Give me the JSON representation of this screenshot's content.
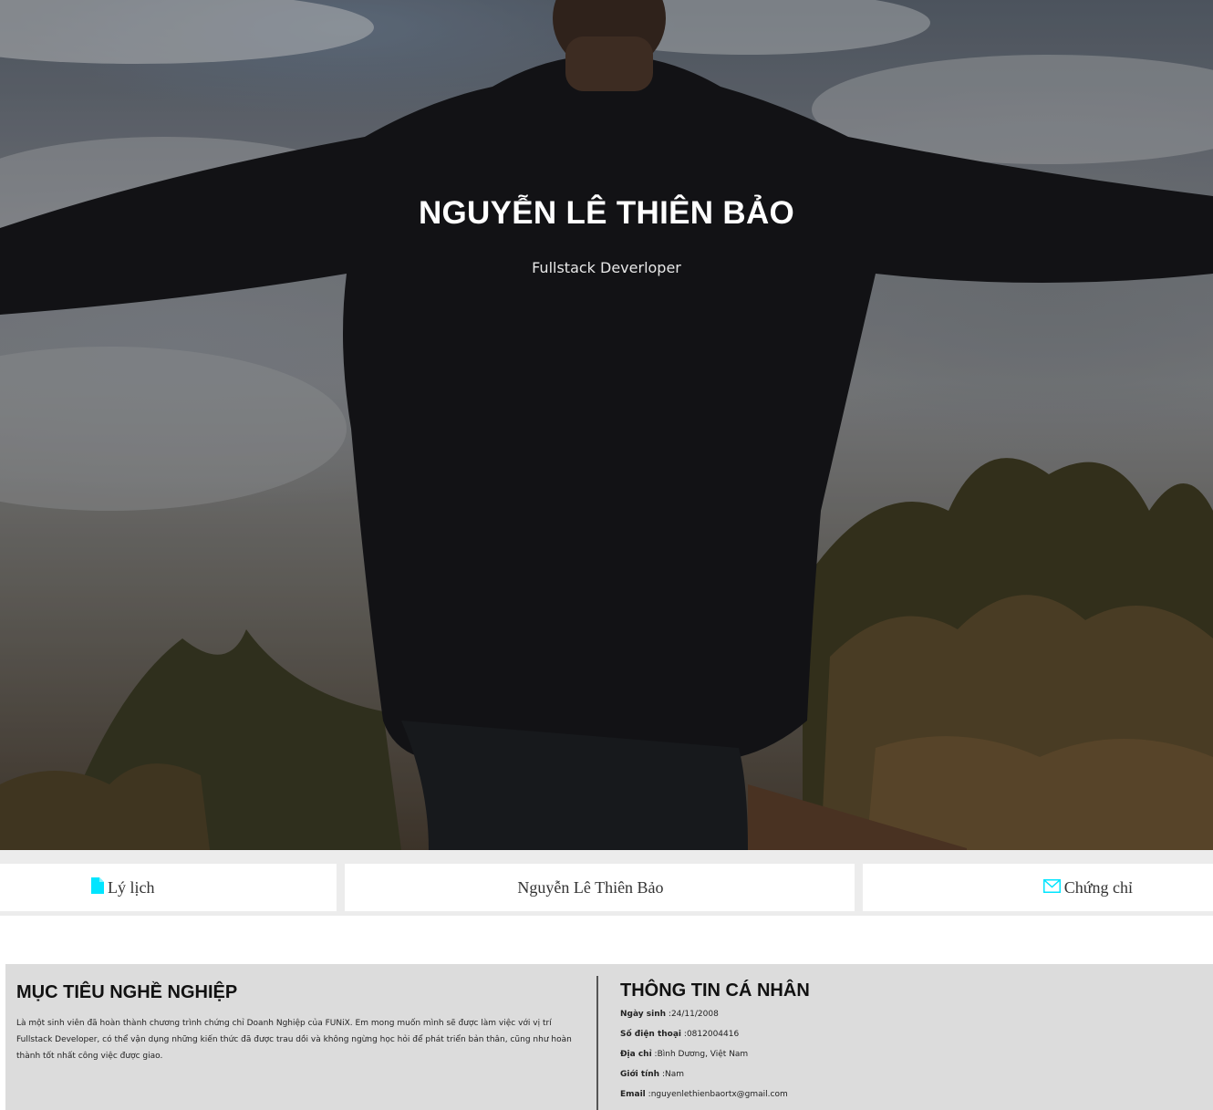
{
  "hero": {
    "name": "NGUYỄN LÊ THIÊN BẢO",
    "role": "Fullstack Deverloper"
  },
  "nav": {
    "left": {
      "icon": "file-icon",
      "label": "Lý lịch",
      "color": "#00e5ff"
    },
    "center": {
      "label": "Nguyễn Lê Thiên Bảo"
    },
    "right": {
      "icon": "envelope-icon",
      "label": "Chứng chỉ",
      "color": "#00e5ff"
    }
  },
  "career": {
    "title": "MỤC TIÊU NGHỀ NGHIỆP",
    "text": "Là một sinh viên đã hoàn thành chương trình chứng chỉ Doanh Nghiệp của FUNiX. Em mong muốn mình sẽ được làm việc với vị trí Fullstack Developer, có thể vận dụng những kiến thức đã được trau dồi và không ngừng học hỏi để phát triển bản thân, cũng như hoàn thành tốt nhất công việc được giao."
  },
  "personal": {
    "title": "THÔNG TIN CÁ NHÂN",
    "items": [
      {
        "label": "Ngày sinh",
        "value": ":24/11/2008"
      },
      {
        "label": "Số điện thoại",
        "value": ":0812004416"
      },
      {
        "label": "Địa chỉ",
        "value": ":Bình Dương, Việt Nam"
      },
      {
        "label": "Giới tính",
        "value": ":Nam"
      },
      {
        "label": "Email",
        "value": ":nguyenlethienbaortx@gmail.com"
      }
    ]
  }
}
